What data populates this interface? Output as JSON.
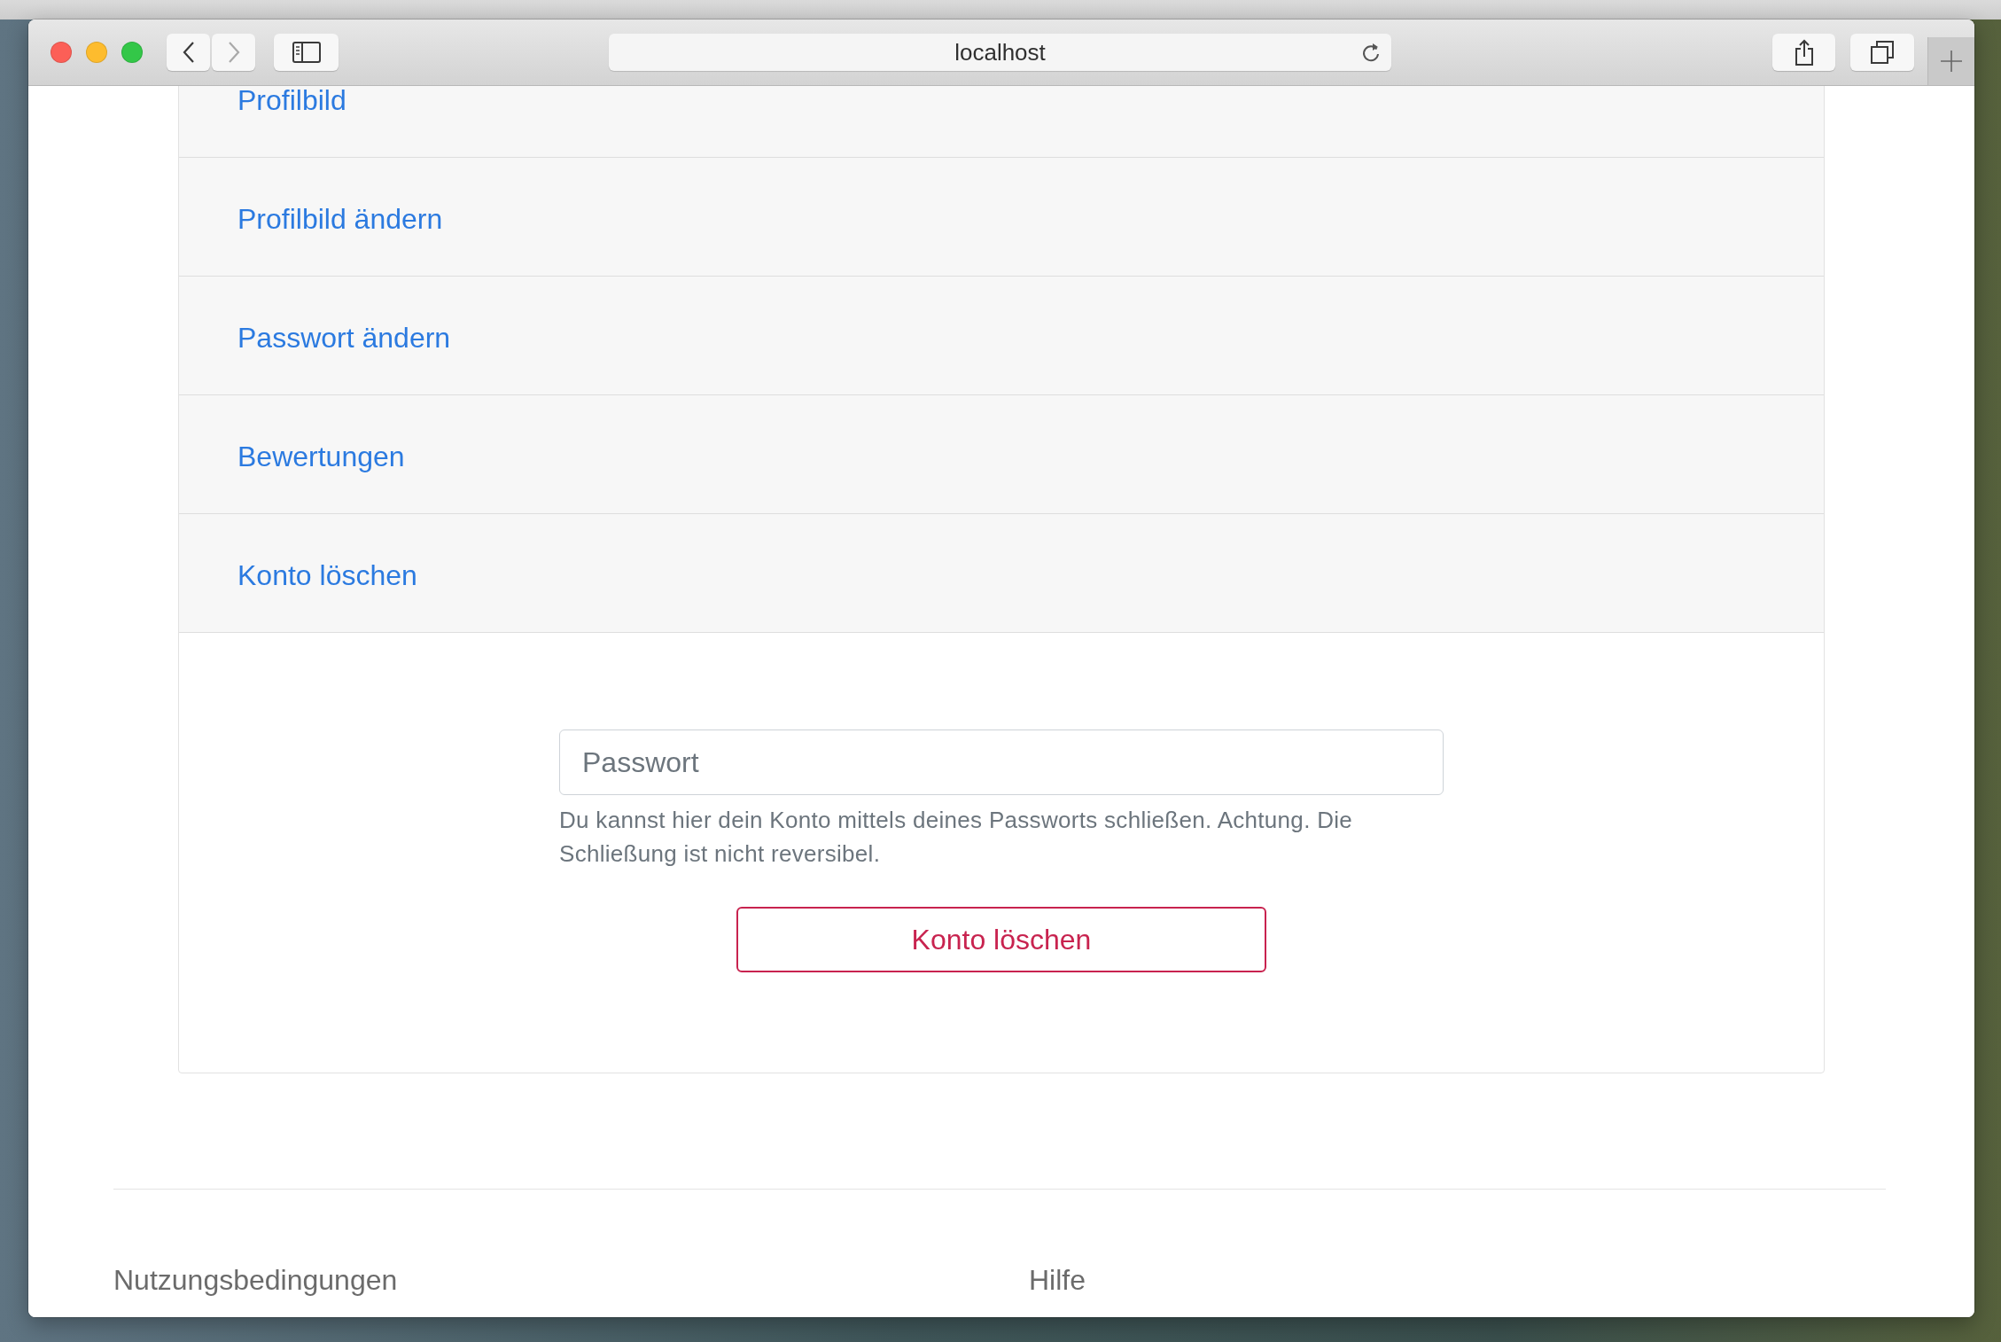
{
  "browser": {
    "url": "localhost",
    "nav_buttons": [
      {
        "kind": "back",
        "disabled": false
      },
      {
        "kind": "forward",
        "disabled": true
      }
    ]
  },
  "settings_menu": [
    "Profilbild",
    "Profilbild ändern",
    "Passwort ändern",
    "Bewertungen",
    "Konto löschen"
  ],
  "delete_account": {
    "password": {
      "placeholder": "Passwort"
    },
    "help_text": "Du kannst hier dein Konto mittels deines Passworts schließen. Achtung. Die Schließung ist nicht reversibel.",
    "button": "Konto löschen"
  },
  "footer": {
    "links": [
      "Nutzungsbedingungen",
      "Hilfe"
    ]
  }
}
